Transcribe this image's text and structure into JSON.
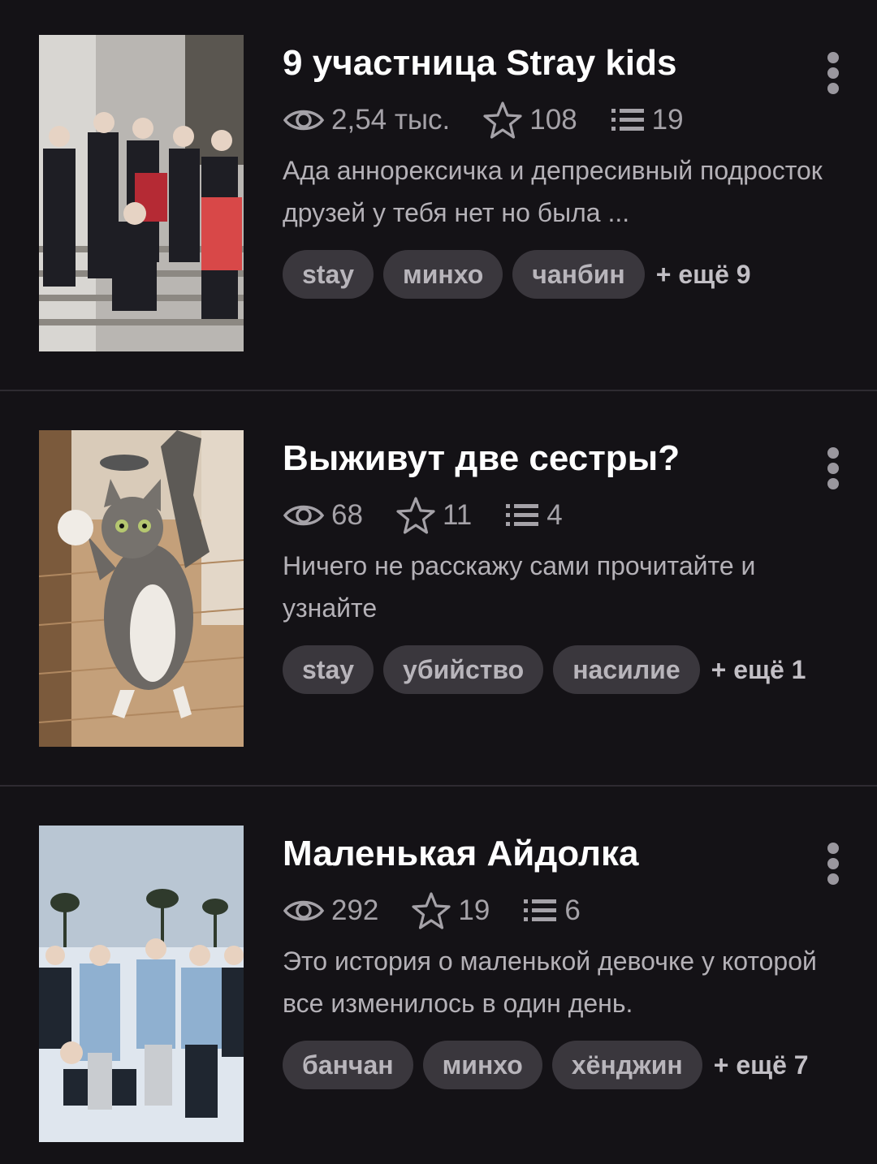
{
  "stories": [
    {
      "title": "9 участница Stray kids",
      "views": "2,54 тыс.",
      "stars": "108",
      "chapters": "19",
      "description": "Ада аннорексичка и депресивный подросток друзей у тебя нет но была ...",
      "tags": [
        "stay",
        "минхо",
        "чанбин"
      ],
      "more_tags": "+ ещё 9",
      "cover_icon": "group-photo-stairs"
    },
    {
      "title": "Выживут две сестры?",
      "views": "68",
      "stars": "11",
      "chapters": "4",
      "description": "Ничего не расскажу сами прочитайте и узнайте",
      "tags": [
        "stay",
        "убийство",
        "насилие"
      ],
      "more_tags": "+ ещё 1",
      "cover_icon": "cat-photo"
    },
    {
      "title": "Маленькая Айдолка",
      "views": "292",
      "stars": "19",
      "chapters": "6",
      "description": "Это история о маленькой девочке у которой все изменилось в один день.",
      "tags": [
        "банчан",
        "минхо",
        "хёнджин"
      ],
      "more_tags": "+ ещё 7",
      "cover_icon": "group-photo-snow"
    }
  ],
  "colors": {
    "background": "#141216",
    "divider": "#2e2b31",
    "tag_bg": "#3a373d",
    "stat_text": "#a5a2a8"
  },
  "icons": {
    "views": "eye-icon",
    "stars": "star-icon",
    "chapters": "list-icon",
    "menu": "more-vertical-icon"
  }
}
